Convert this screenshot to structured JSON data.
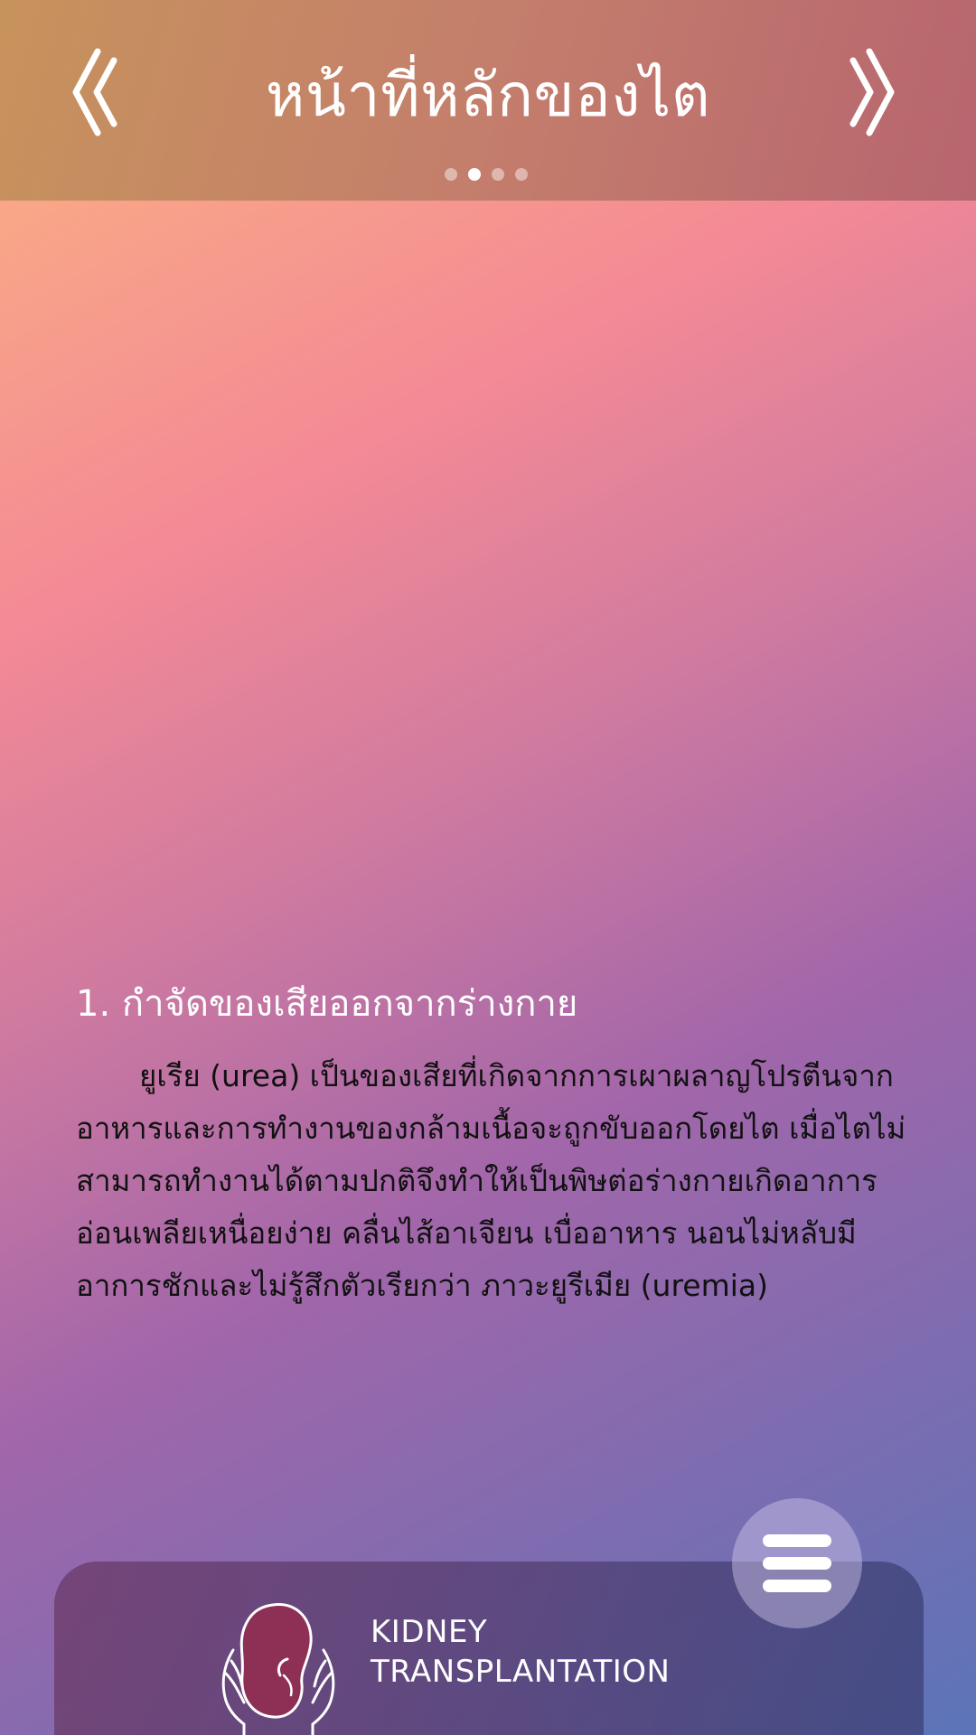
{
  "header": {
    "title": "หน้าที่หลักของไต",
    "prev_icon": "double-chevron-left-icon",
    "next_icon": "double-chevron-right-icon",
    "pagination": {
      "total": 4,
      "active_index": 1
    }
  },
  "content": {
    "heading": "1. กำจัดของเสียออกจากร่างกาย",
    "body": "ยูเรีย (urea) เป็นของเสียที่เกิดจากการเผาผลาญโปรตีนจากอาหารและการทำงานของกล้ามเนื้อจะถูกขับออกโดยไต เมื่อไตไม่สามารถทำงานได้ตามปกติจึงทำให้เป็นพิษต่อร่างกายเกิดอาการอ่อนเพลียเหนื่อยง่าย คลื่นไส้อาเจียน เบื่ออาหาร นอนไม่หลับมีอาการชักและไม่รู้สึกตัวเรียกว่า ภาวะยูรีเมีย (uremia)"
  },
  "brand": {
    "logo_icon": "kidney-in-hands-icon",
    "line1": "KIDNEY",
    "line2": "TRANSPLANTATION"
  },
  "menu": {
    "icon": "hamburger-menu-icon"
  },
  "colors": {
    "kidney": "#8e2f55",
    "text_dark": "#111111",
    "text_light": "#ffffff"
  }
}
